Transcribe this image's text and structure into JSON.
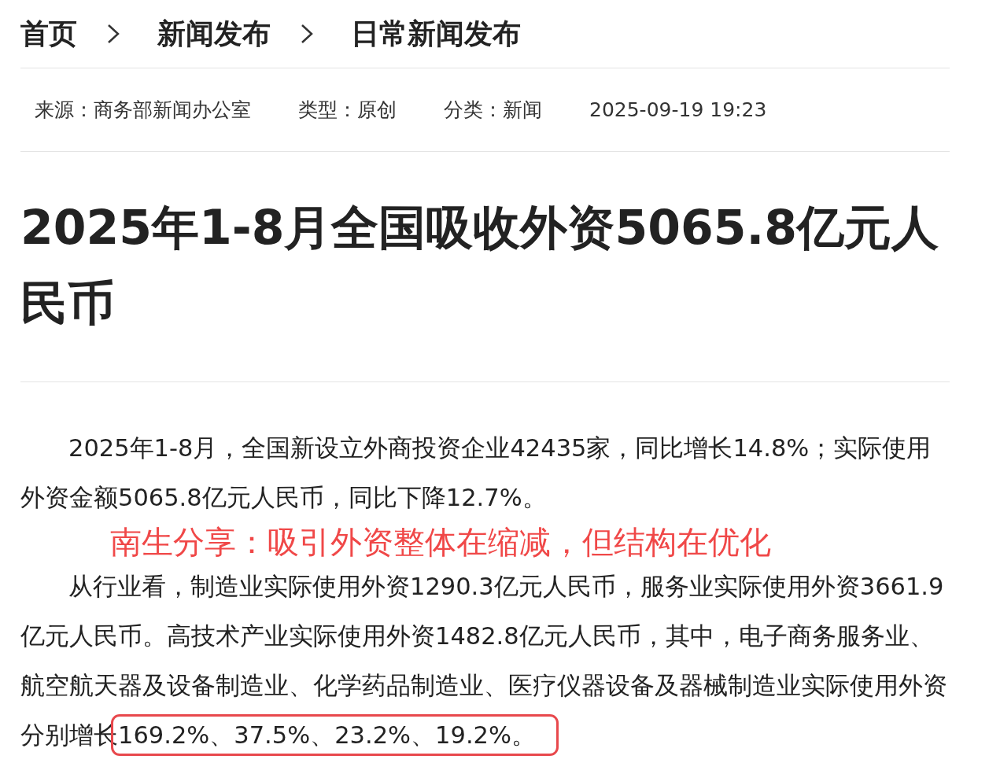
{
  "breadcrumb": [
    {
      "label": "首页"
    },
    {
      "label": "新闻发布"
    },
    {
      "label": "日常新闻发布"
    }
  ],
  "meta": [
    "来源：商务部新闻办公室",
    "类型：原创",
    "分类：新闻",
    "2025-09-19 19:23"
  ],
  "article": {
    "title": "2025年1-8月全国吸收外资5065.8亿元人民币",
    "blocks": [
      {
        "kind": "paragraph",
        "text": "2025年1-8月，全国新设立外商投资企业42435家，同比增长14.8%；实际使用外资金额5065.8亿元人民币，同比下降12.7%。"
      },
      {
        "kind": "annotation",
        "text": "南生分享：吸引外资整体在缩减，但结构在优化"
      },
      {
        "kind": "paragraph",
        "text": "从行业看，制造业实际使用外资1290.3亿元人民币，服务业实际使用外资3661.9亿元人民币。高技术产业实际使用外资1482.8亿元人民币，其中，电子商务服务业、航空航天器及设备制造业、化学药品制造业、医疗仪器设备及器械制造业实际使用外资分别增长",
        "highlighted": "169.2%、37.5%、23.2%、19.2%。"
      }
    ]
  }
}
